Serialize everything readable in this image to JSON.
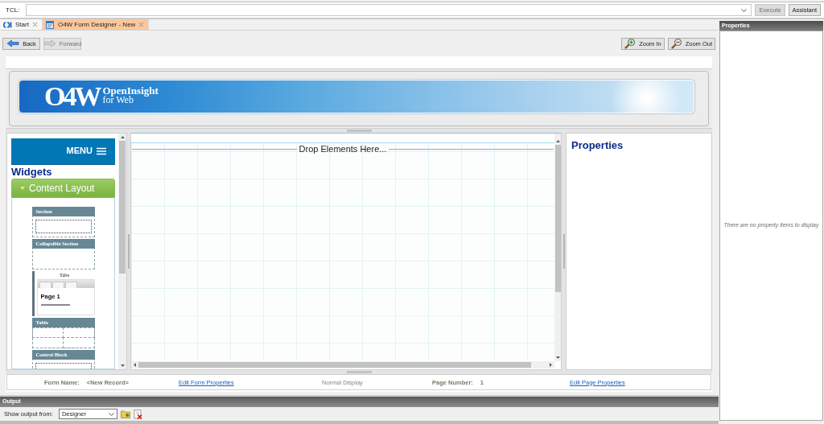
{
  "command_bar": {
    "label": "TCL:",
    "buttons": [
      {
        "label": "Execute",
        "disabled": true
      },
      {
        "label": "Assistant",
        "disabled": false
      }
    ]
  },
  "tabs": [
    {
      "label": "Start",
      "kind": "start",
      "selected": false
    },
    {
      "label": "O4W Form Designer - New",
      "kind": "designer",
      "selected": true
    }
  ],
  "toolbar": {
    "nav_buttons": [
      {
        "label": "Back",
        "kind": "back",
        "disabled": false
      },
      {
        "label": "Forward",
        "kind": "forward",
        "disabled": true
      }
    ],
    "zoom_buttons": [
      {
        "label": "Zoom In",
        "kind": "in"
      },
      {
        "label": "Zoom Out",
        "kind": "out"
      }
    ]
  },
  "banner": {
    "logo": "O4W",
    "title": "OpenInsight",
    "subtitle": "for Web"
  },
  "widget_panel": {
    "menu": "MENU",
    "heading": "Widgets",
    "group": {
      "label": "Content Layout",
      "expanded": true
    },
    "widgets": [
      {
        "kind": "section",
        "label": "Section"
      },
      {
        "kind": "collapsible",
        "label": "Collapsible Section"
      },
      {
        "kind": "tabs",
        "label": "Tabs",
        "page_title": "Page 1"
      },
      {
        "kind": "table",
        "label": "Table"
      },
      {
        "kind": "section",
        "label": "Control Block"
      }
    ]
  },
  "canvas": {
    "drop_hint": "Drop Elements Here..."
  },
  "properties_panel": {
    "heading": "Properties"
  },
  "info_bar": [
    {
      "kind": "field",
      "label": "Form Name:",
      "value": "<New Record>"
    },
    {
      "kind": "link",
      "text": "Edit Form Properties"
    },
    {
      "kind": "text",
      "text": "Normal Display"
    },
    {
      "kind": "field",
      "label": "Page Number:",
      "value": "1"
    },
    {
      "kind": "link",
      "text": "Edit Page Properties"
    }
  ],
  "properties_pane": {
    "title": "Properties",
    "empty_message": "There are no property items to display"
  },
  "output_panel": {
    "title": "Output",
    "label": "Show output from:",
    "source": "Designer"
  }
}
